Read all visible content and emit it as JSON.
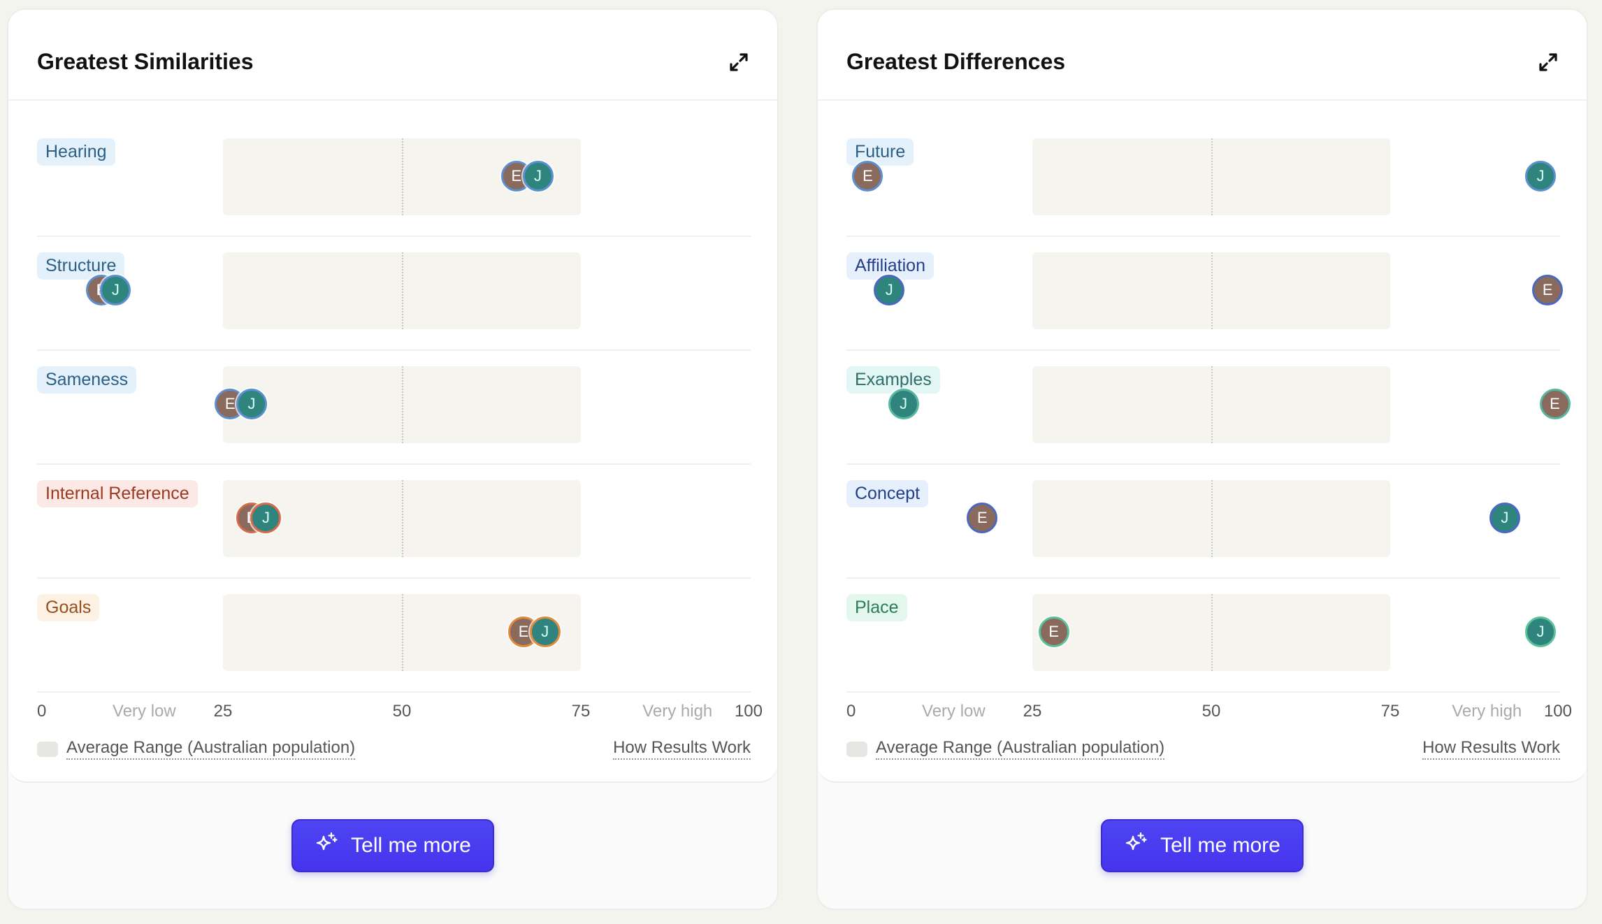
{
  "cards": [
    {
      "title": "Greatest Similarities",
      "expand_icon": "expand-arrows-icon",
      "button_label": "Tell me more",
      "button_icon": "sparkle-icon",
      "legend_label": "Average Range (Australian population)",
      "how_link": "How Results Work"
    },
    {
      "title": "Greatest Differences",
      "expand_icon": "expand-arrows-icon",
      "button_label": "Tell me more",
      "button_icon": "sparkle-icon",
      "legend_label": "Average Range (Australian population)",
      "how_link": "How Results Work"
    }
  ],
  "axis": {
    "ticks": [
      {
        "label": "0",
        "value": 0,
        "kind": "num"
      },
      {
        "label": "Very low",
        "value": 14,
        "kind": "word"
      },
      {
        "label": "25",
        "value": 25,
        "kind": "num"
      },
      {
        "label": "50",
        "value": 50,
        "kind": "num"
      },
      {
        "label": "75",
        "value": 75,
        "kind": "num"
      },
      {
        "label": "Very high",
        "value": 88.5,
        "kind": "word"
      },
      {
        "label": "100",
        "value": 100,
        "kind": "num"
      }
    ]
  },
  "palette": {
    "blue": {
      "bg": "#e4f1fb",
      "fg": "#2b5f86",
      "ring": "#5b8fd0"
    },
    "indigo": {
      "bg": "#e6effc",
      "fg": "#243f8a",
      "ring": "#4a68c0"
    },
    "teal": {
      "bg": "#e2f6f6",
      "fg": "#2f6f6a",
      "ring": "#57b7a0"
    },
    "red": {
      "bg": "#fce8e4",
      "fg": "#9a3a22",
      "ring": "#d86a4a"
    },
    "orange": {
      "bg": "#fdf1e4",
      "fg": "#94501e",
      "ring": "#e08a40"
    },
    "mint": {
      "bg": "#e4f7ef",
      "fg": "#2d7b5e",
      "ring": "#5cc09a"
    },
    "person_E": "#8a6a5c",
    "person_J": "#2f857d",
    "accent": "#4a3ff0"
  },
  "chart_data": [
    {
      "type": "scatter",
      "title": "Greatest Similarities",
      "xlim": [
        0,
        100
      ],
      "average_range": [
        25,
        75
      ],
      "midline": 50,
      "x_tick_labels": [
        "0",
        "Very low",
        "25",
        "50",
        "75",
        "Very high",
        "100"
      ],
      "legend": [
        "Average Range (Australian population)"
      ],
      "series_names": [
        "E",
        "J"
      ],
      "categories": [
        {
          "label": "Hearing",
          "color": "blue",
          "E": 66,
          "J": 69
        },
        {
          "label": "Structure",
          "color": "blue",
          "E": 8,
          "J": 10
        },
        {
          "label": "Sameness",
          "color": "blue",
          "E": 26,
          "J": 29
        },
        {
          "label": "Internal Reference",
          "color": "red",
          "E": 29,
          "J": 31
        },
        {
          "label": "Goals",
          "color": "orange",
          "E": 67,
          "J": 70
        }
      ]
    },
    {
      "type": "scatter",
      "title": "Greatest Differences",
      "xlim": [
        0,
        100
      ],
      "average_range": [
        25,
        75
      ],
      "midline": 50,
      "x_tick_labels": [
        "0",
        "Very low",
        "25",
        "50",
        "75",
        "Very high",
        "100"
      ],
      "legend": [
        "Average Range (Australian population)"
      ],
      "series_names": [
        "E",
        "J"
      ],
      "categories": [
        {
          "label": "Future",
          "color": "blue",
          "E": 2,
          "J": 96
        },
        {
          "label": "Affiliation",
          "color": "indigo",
          "E": 97,
          "J": 5
        },
        {
          "label": "Examples",
          "color": "teal",
          "E": 98,
          "J": 7
        },
        {
          "label": "Concept",
          "color": "indigo",
          "E": 18,
          "J": 91
        },
        {
          "label": "Place",
          "color": "mint",
          "E": 28,
          "J": 96
        }
      ]
    }
  ]
}
